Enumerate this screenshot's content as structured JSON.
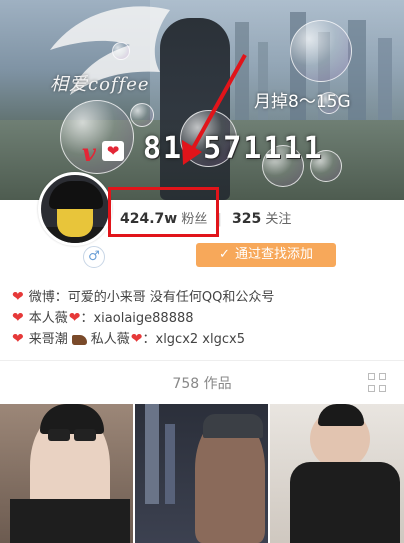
{
  "banner": {
    "handwriting": "相爱coffee",
    "overlay_size": "月掉8～15G",
    "overlay_v": "v",
    "overlay_heart": "❤",
    "overlay_number": "81 571111"
  },
  "profile": {
    "gender_symbol": "♂",
    "followers_count": "424.7w",
    "followers_label": "粉丝",
    "following_count": "325",
    "following_label": "关注",
    "follow_button": "通过查找添加",
    "follow_button_icon": "✓"
  },
  "bio": {
    "heart": "❤",
    "line1": "微博：可爱的小来哥 没有任何QQ和公众号",
    "line2_prefix": "本人薇",
    "line2_suffix": "：xiaolaige88888",
    "line3_prefix": "来哥潮",
    "line3_middle": "私人薇",
    "line3_suffix": "：xlgcx2    xlgcx5"
  },
  "works": {
    "label": "758 作品"
  },
  "colors": {
    "accent": "#f7a85a",
    "highlight": "#e1141a",
    "heart": "#e63939"
  }
}
